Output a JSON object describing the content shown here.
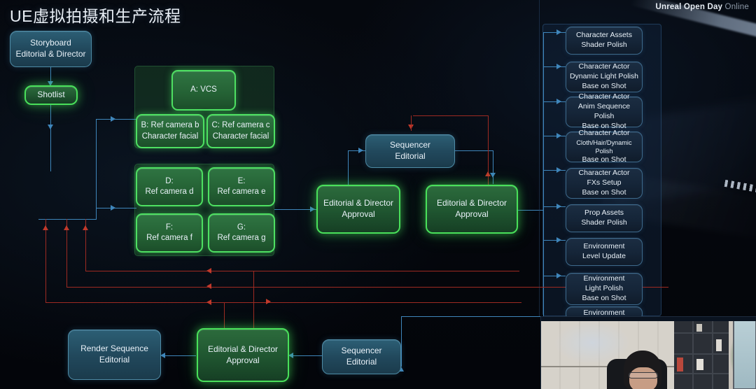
{
  "header": {
    "title": "UE虚拟拍摄和生产流程",
    "brand_bold": "Unreal Open Day",
    "brand_light": "Online"
  },
  "nodes": {
    "storyboard": {
      "l1": "Storyboard",
      "l2": "Editorial & Director"
    },
    "shotlist": {
      "l1": "Shotlist"
    },
    "vcs": {
      "l1": "A: VCS"
    },
    "ref_b": {
      "l1": "B: Ref camera b",
      "l2": "Character facial"
    },
    "ref_c": {
      "l1": "C: Ref camera c",
      "l2": "Character facial"
    },
    "ref_d": {
      "l1": "D:",
      "l2": "Ref camera d"
    },
    "ref_e": {
      "l1": "E:",
      "l2": "Ref camera e"
    },
    "ref_f": {
      "l1": "F:",
      "l2": "Ref camera f"
    },
    "ref_g": {
      "l1": "G:",
      "l2": "Ref camera g"
    },
    "sequencer_mid": {
      "l1": "Sequencer",
      "l2": "Editorial"
    },
    "approval_left": {
      "l1": "Editorial & Director",
      "l2": "Approval"
    },
    "approval_right": {
      "l1": "Editorial & Director",
      "l2": "Approval"
    },
    "render_sequence": {
      "l1": "Render Sequence",
      "l2": "Editorial"
    },
    "approval_bottom": {
      "l1": "Editorial & Director",
      "l2": "Approval"
    },
    "sequencer_bottom": {
      "l1": "Sequencer",
      "l2": "Editorial"
    }
  },
  "right_column": [
    {
      "l1": "Character Assets",
      "l2": "Shader Polish",
      "l3": ""
    },
    {
      "l1": "Character Actor",
      "l2": "Dynamic Light Polish",
      "l3": "Base on Shot"
    },
    {
      "l1": "Character Actor",
      "l2": "Anim Sequence Polish",
      "l3": "Base on Shot"
    },
    {
      "l1": "Character Actor",
      "l2": "Cloth/Hair/Dynamic Polish",
      "l3": "Base on Shot"
    },
    {
      "l1": "Character Actor",
      "l2": "FXs Setup",
      "l3": "Base on Shot"
    },
    {
      "l1": "Prop Assets",
      "l2": "Shader Polish",
      "l3": ""
    },
    {
      "l1": "Environment",
      "l2": "Level Update",
      "l3": ""
    },
    {
      "l1": "Environment",
      "l2": "Light Polish",
      "l3": "Base on Shot"
    },
    {
      "l1": "Environment",
      "l2": "",
      "l3": ""
    }
  ],
  "colors": {
    "green_border": "#49e05a",
    "green_fill": "#1f5530",
    "blue_border": "#4e8ba6",
    "blue_fill": "#21485c",
    "dark_blue_fill": "#152538",
    "connector_blue": "#3f86bb",
    "connector_red": "#c0392b",
    "background": "#05070c",
    "text": "#e9f1f8"
  }
}
